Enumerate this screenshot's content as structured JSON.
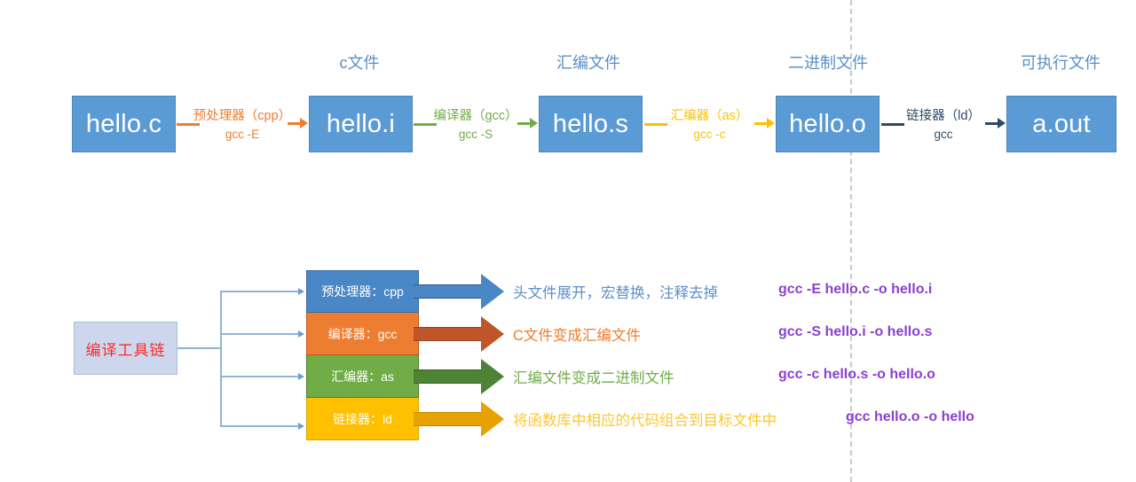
{
  "colors": {
    "box_blue": "#5B9BD5",
    "label_blue": "#5B8FC9",
    "orange": "#ED7D31",
    "green": "#70AD47",
    "yellow": "#FFC000",
    "navy": "#2E4A66",
    "purple": "#8B3FD1",
    "red": "#FF2A2A",
    "toolchain_bg": "#CCD7EE",
    "divider": "#C9C9C9"
  },
  "pipeline": {
    "boxes": [
      {
        "name": "hello.c",
        "stage_label": ""
      },
      {
        "name": "hello.i",
        "stage_label": "c文件"
      },
      {
        "name": "hello.s",
        "stage_label": "汇编文件"
      },
      {
        "name": "hello.o",
        "stage_label": "二进制文件"
      },
      {
        "name": "a.out",
        "stage_label": "可执行文件"
      }
    ],
    "connectors": [
      {
        "tool": "预处理器（cpp）",
        "cmd": "gcc -E",
        "color": "#ED7D31"
      },
      {
        "tool": "编译器（gcc）",
        "cmd": "gcc -S",
        "color": "#70AD47"
      },
      {
        "tool": "汇编器（as）",
        "cmd": "gcc -c",
        "color": "#FFC000"
      },
      {
        "tool": "链接器（ld）",
        "cmd": "gcc",
        "color": "#2E4A66"
      }
    ]
  },
  "toolchain": {
    "root_label": "编译工具链",
    "rows": [
      {
        "tool": "预处理器：cpp",
        "color": "#4A87C7",
        "border": "#35689E",
        "description": "头文件展开，宏替换，注释去掉",
        "desc_color": "#5B8FC9",
        "command": "gcc -E hello.c -o hello.i"
      },
      {
        "tool": "编译器：gcc",
        "color": "#ED7D31",
        "border": "#C2551B",
        "description": "C文件变成汇编文件",
        "desc_color": "#ED7D31",
        "command": "gcc -S hello.i -o hello.s"
      },
      {
        "tool": "汇编器：as",
        "color": "#70AD47",
        "border": "#4D7D2C",
        "description": "汇编文件变成二进制文件",
        "desc_color": "#70AD47",
        "command": "gcc -c hello.s -o hello.o"
      },
      {
        "tool": "链接器：ld",
        "color": "#FFC000",
        "border": "#D9A300",
        "description": "将函数库中相应的代码组合到目标文件中",
        "desc_color": "#FFC72C",
        "command": "gcc hello.o -o hello"
      }
    ]
  }
}
